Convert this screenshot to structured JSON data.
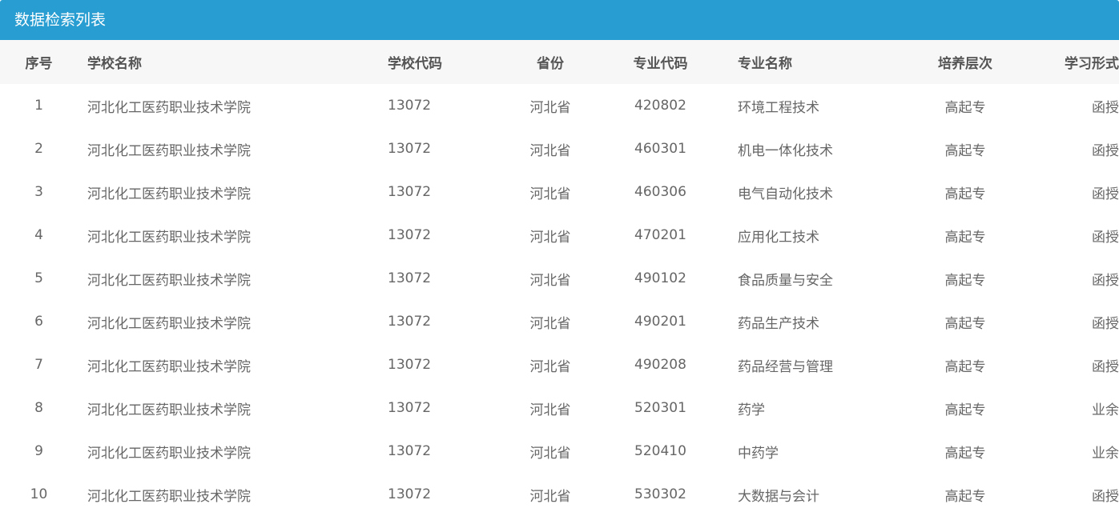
{
  "panel": {
    "title": "数据检索列表"
  },
  "table": {
    "headers": {
      "index": "序号",
      "school_name": "学校名称",
      "school_code": "学校代码",
      "province": "省份",
      "major_code": "专业代码",
      "major_name": "专业名称",
      "level": "培养层次",
      "study_mode": "学习形式"
    },
    "rows": [
      {
        "index": "1",
        "school_name": "河北化工医药职业技术学院",
        "school_code": "13072",
        "province": "河北省",
        "major_code": "420802",
        "major_name": "环境工程技术",
        "level": "高起专",
        "study_mode": "函授"
      },
      {
        "index": "2",
        "school_name": "河北化工医药职业技术学院",
        "school_code": "13072",
        "province": "河北省",
        "major_code": "460301",
        "major_name": "机电一体化技术",
        "level": "高起专",
        "study_mode": "函授"
      },
      {
        "index": "3",
        "school_name": "河北化工医药职业技术学院",
        "school_code": "13072",
        "province": "河北省",
        "major_code": "460306",
        "major_name": "电气自动化技术",
        "level": "高起专",
        "study_mode": "函授"
      },
      {
        "index": "4",
        "school_name": "河北化工医药职业技术学院",
        "school_code": "13072",
        "province": "河北省",
        "major_code": "470201",
        "major_name": "应用化工技术",
        "level": "高起专",
        "study_mode": "函授"
      },
      {
        "index": "5",
        "school_name": "河北化工医药职业技术学院",
        "school_code": "13072",
        "province": "河北省",
        "major_code": "490102",
        "major_name": "食品质量与安全",
        "level": "高起专",
        "study_mode": "函授"
      },
      {
        "index": "6",
        "school_name": "河北化工医药职业技术学院",
        "school_code": "13072",
        "province": "河北省",
        "major_code": "490201",
        "major_name": "药品生产技术",
        "level": "高起专",
        "study_mode": "函授"
      },
      {
        "index": "7",
        "school_name": "河北化工医药职业技术学院",
        "school_code": "13072",
        "province": "河北省",
        "major_code": "490208",
        "major_name": "药品经营与管理",
        "level": "高起专",
        "study_mode": "函授"
      },
      {
        "index": "8",
        "school_name": "河北化工医药职业技术学院",
        "school_code": "13072",
        "province": "河北省",
        "major_code": "520301",
        "major_name": "药学",
        "level": "高起专",
        "study_mode": "业余"
      },
      {
        "index": "9",
        "school_name": "河北化工医药职业技术学院",
        "school_code": "13072",
        "province": "河北省",
        "major_code": "520410",
        "major_name": "中药学",
        "level": "高起专",
        "study_mode": "业余"
      },
      {
        "index": "10",
        "school_name": "河北化工医药职业技术学院",
        "school_code": "13072",
        "province": "河北省",
        "major_code": "530302",
        "major_name": "大数据与会计",
        "level": "高起专",
        "study_mode": "函授"
      }
    ]
  },
  "colors": {
    "header_bar": "#279dd1",
    "table_head_bg": "#f7f7f7",
    "text": "#666666"
  }
}
